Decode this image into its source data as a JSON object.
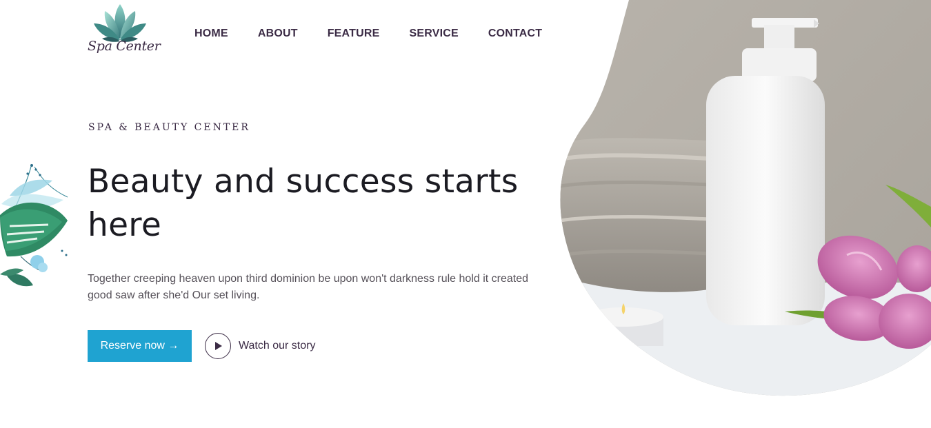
{
  "brand": {
    "logo_text": "Spa Center"
  },
  "nav": {
    "items": [
      {
        "label": "HOME"
      },
      {
        "label": "ABOUT"
      },
      {
        "label": "FEATURE"
      },
      {
        "label": "SERVICE"
      },
      {
        "label": "CONTACT"
      }
    ]
  },
  "hero": {
    "eyebrow": "SPA & BEAUTY CENTER",
    "headline": "Beauty and success starts here",
    "description": "Together creeping heaven upon third dominion be upon won't darkness rule hold it created good saw after she'd Our set living.",
    "reserve_label": "Reserve now →",
    "watch_label": "Watch our story"
  },
  "icons": {
    "logo": "lotus-logo-icon",
    "play": "play-icon",
    "decoration": "leaves-illustration"
  },
  "colors": {
    "accent": "#1fa3d1",
    "text_dark": "#3b2b45",
    "heading": "#1b1b22",
    "body_text": "#555058"
  }
}
